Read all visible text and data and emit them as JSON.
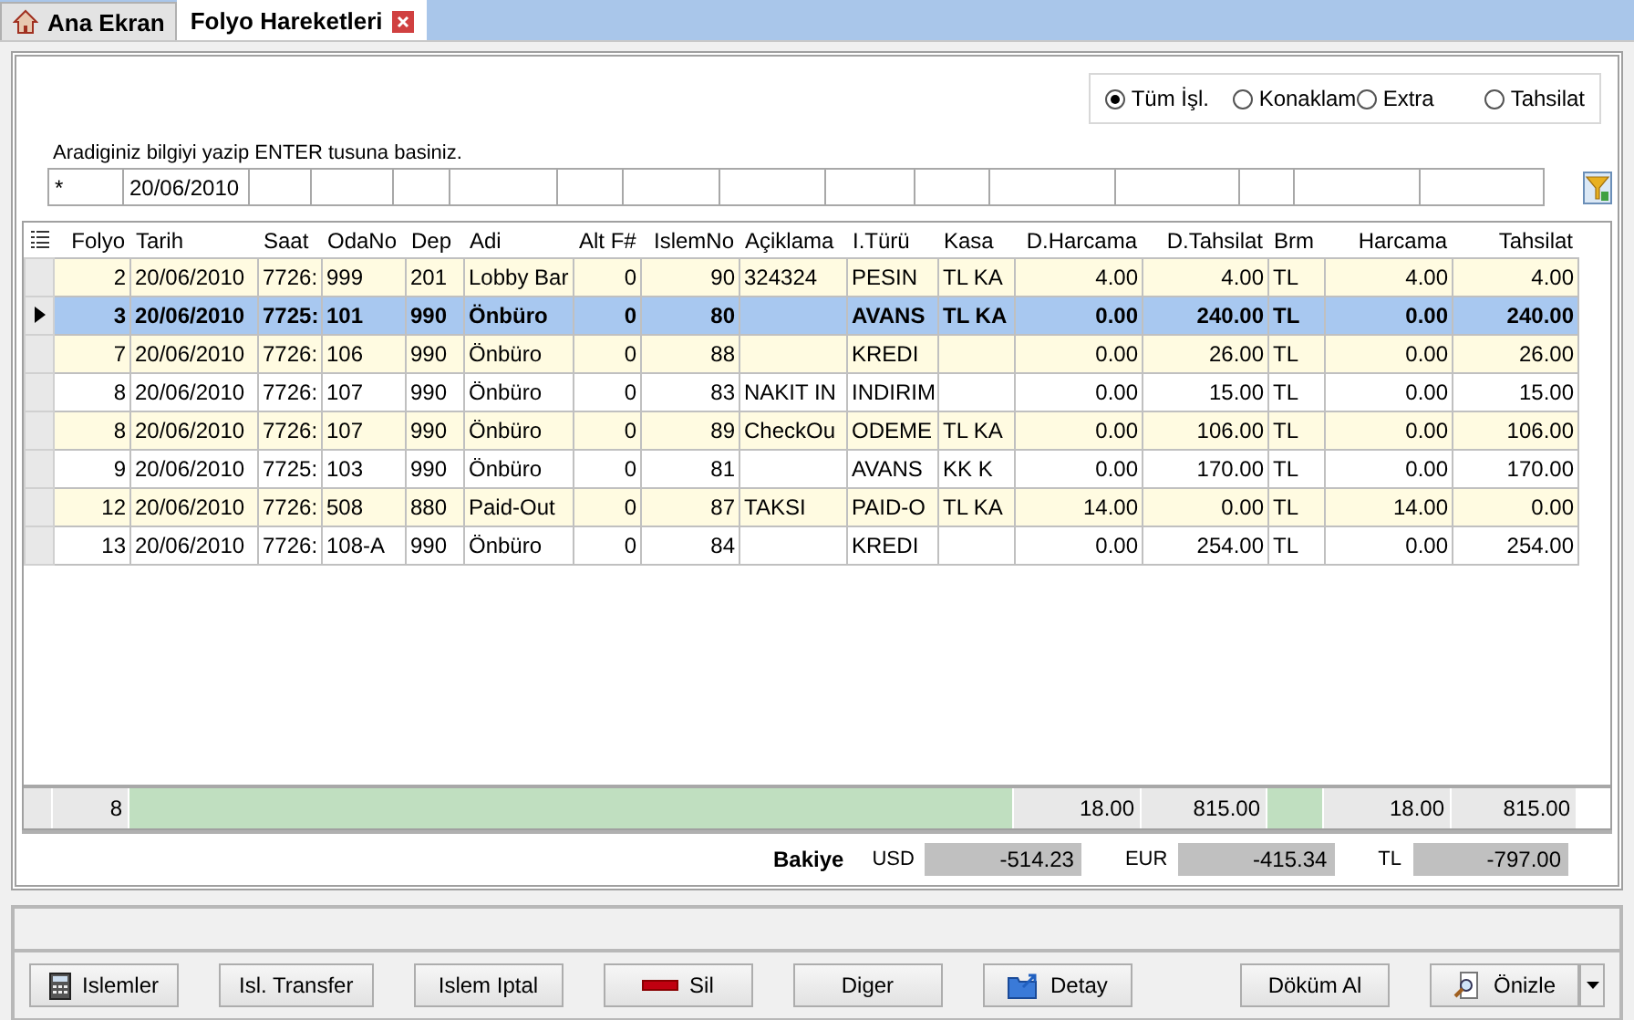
{
  "tabs": [
    {
      "label": "Ana Ekran",
      "kind": "home",
      "selected": false
    },
    {
      "label": "Folyo Hareketleri",
      "kind": "closable",
      "selected": true
    }
  ],
  "filter_options": [
    {
      "label": "Tüm İşl.",
      "selected": true
    },
    {
      "label": "Konaklam",
      "selected": false
    },
    {
      "label": "Extra",
      "selected": false
    },
    {
      "label": "Tahsilat",
      "selected": false
    }
  ],
  "search_hint": "Aradiginiz bilgiyi yazip ENTER tusuna basiniz.",
  "search_fields": [
    {
      "value": "*"
    },
    {
      "value": "20/06/2010"
    }
  ],
  "table": {
    "columns": [
      "Folyo",
      "Tarih",
      "Saat",
      "OdaNo",
      "Dep",
      "Adi",
      "Alt F#",
      "IslemNo",
      "Açiklama",
      "I.Türü",
      "Kasa",
      "D.Harcama",
      "D.Tahsilat",
      "Brm",
      "Harcama",
      "Tahsilat"
    ],
    "rows": [
      {
        "selected": false,
        "cells": [
          "2",
          "20/06/2010",
          "7726:",
          "999",
          "201",
          "Lobby Bar",
          "0",
          "90",
          "324324",
          "PESIN",
          "TL KA",
          "4.00",
          "4.00",
          "TL",
          "4.00",
          "4.00"
        ]
      },
      {
        "selected": true,
        "cells": [
          "3",
          "20/06/2010",
          "7725:",
          "101",
          "990",
          "Önbüro",
          "0",
          "80",
          "",
          "AVANS",
          "TL KA",
          "0.00",
          "240.00",
          "TL",
          "0.00",
          "240.00"
        ]
      },
      {
        "selected": false,
        "cells": [
          "7",
          "20/06/2010",
          "7726:",
          "106",
          "990",
          "Önbüro",
          "0",
          "88",
          "",
          "KREDI",
          "",
          "0.00",
          "26.00",
          "TL",
          "0.00",
          "26.00"
        ]
      },
      {
        "selected": false,
        "cells": [
          "8",
          "20/06/2010",
          "7726:",
          "107",
          "990",
          "Önbüro",
          "0",
          "83",
          "NAKIT IN",
          "INDIRIM",
          "",
          "0.00",
          "15.00",
          "TL",
          "0.00",
          "15.00"
        ]
      },
      {
        "selected": false,
        "cells": [
          "8",
          "20/06/2010",
          "7726:",
          "107",
          "990",
          "Önbüro",
          "0",
          "89",
          "CheckOu",
          "ODEME",
          "TL KA",
          "0.00",
          "106.00",
          "TL",
          "0.00",
          "106.00"
        ]
      },
      {
        "selected": false,
        "cells": [
          "9",
          "20/06/2010",
          "7725:",
          "103",
          "990",
          "Önbüro",
          "0",
          "81",
          "",
          "AVANS",
          "KK K",
          "0.00",
          "170.00",
          "TL",
          "0.00",
          "170.00"
        ]
      },
      {
        "selected": false,
        "cells": [
          "12",
          "20/06/2010",
          "7726:",
          "508",
          "880",
          "Paid-Out",
          "0",
          "87",
          "TAKSI",
          "PAID-O",
          "TL KA",
          "14.00",
          "0.00",
          "TL",
          "14.00",
          "0.00"
        ]
      },
      {
        "selected": false,
        "cells": [
          "13",
          "20/06/2010",
          "7726:",
          "108-A",
          "990",
          "Önbüro",
          "0",
          "84",
          "",
          "KREDI",
          "",
          "0.00",
          "254.00",
          "TL",
          "0.00",
          "254.00"
        ]
      }
    ],
    "totals": {
      "count": "8",
      "d_harcama": "18.00",
      "d_tahsilat": "815.00",
      "harcama": "18.00",
      "tahsilat": "815.00"
    }
  },
  "balance": {
    "label": "Bakiye",
    "items": [
      {
        "currency": "USD",
        "value": "-514.23"
      },
      {
        "currency": "EUR",
        "value": "-415.34"
      },
      {
        "currency": "TL",
        "value": "-797.00"
      }
    ]
  },
  "buttons": [
    "Islemler",
    "Isl. Transfer",
    "Islem Iptal",
    "Sil",
    "Diger",
    "Detay",
    "Döküm Al",
    "Önizle"
  ]
}
